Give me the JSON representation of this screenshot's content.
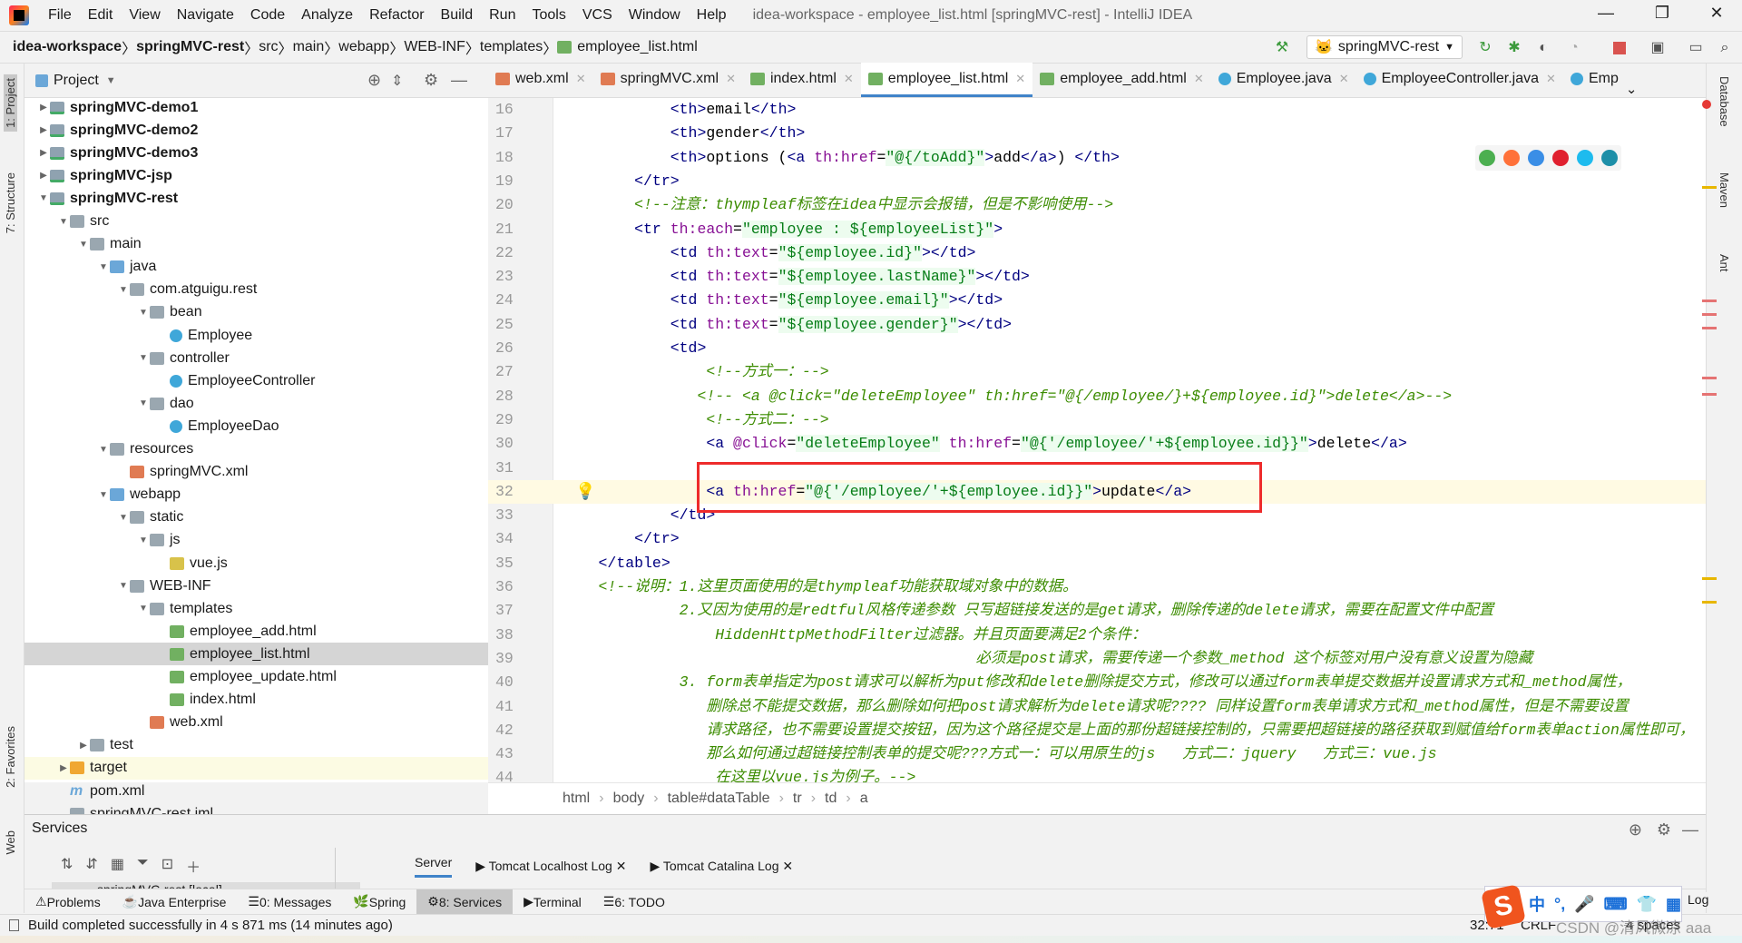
{
  "window": {
    "title": "idea-workspace - employee_list.html [springMVC-rest] - IntelliJ IDEA",
    "minimize": "—",
    "maximize": "❐",
    "close": "✕"
  },
  "menu": [
    "File",
    "Edit",
    "View",
    "Navigate",
    "Code",
    "Analyze",
    "Refactor",
    "Build",
    "Run",
    "Tools",
    "VCS",
    "Window",
    "Help"
  ],
  "navbar": {
    "crumbs": [
      "idea-workspace",
      "springMVC-rest",
      "src",
      "main",
      "webapp",
      "WEB-INF",
      "templates",
      "employee_list.html"
    ],
    "run_config": "springMVC-rest"
  },
  "left_stripe": [
    "1: Project",
    "7: Structure",
    "2: Favorites",
    "Web"
  ],
  "right_stripe": [
    "Database",
    "Maven",
    "Ant"
  ],
  "project": {
    "title": "Project",
    "tree": [
      {
        "label": "springMVC-demo1",
        "depth": 0,
        "arrow": "closed",
        "icon": "module",
        "bold": true
      },
      {
        "label": "springMVC-demo2",
        "depth": 0,
        "arrow": "closed",
        "icon": "module",
        "bold": true
      },
      {
        "label": "springMVC-demo3",
        "depth": 0,
        "arrow": "closed",
        "icon": "module",
        "bold": true
      },
      {
        "label": "springMVC-jsp",
        "depth": 0,
        "arrow": "closed",
        "icon": "module",
        "bold": true
      },
      {
        "label": "springMVC-rest",
        "depth": 0,
        "arrow": "open",
        "icon": "module",
        "bold": true
      },
      {
        "label": "src",
        "depth": 1,
        "arrow": "open",
        "icon": "folder"
      },
      {
        "label": "main",
        "depth": 2,
        "arrow": "open",
        "icon": "folder"
      },
      {
        "label": "java",
        "depth": 3,
        "arrow": "open",
        "icon": "src"
      },
      {
        "label": "com.atguigu.rest",
        "depth": 4,
        "arrow": "open",
        "icon": "folder"
      },
      {
        "label": "bean",
        "depth": 5,
        "arrow": "open",
        "icon": "folder"
      },
      {
        "label": "Employee",
        "depth": 6,
        "arrow": "none",
        "icon": "class"
      },
      {
        "label": "controller",
        "depth": 5,
        "arrow": "open",
        "icon": "folder"
      },
      {
        "label": "EmployeeController",
        "depth": 6,
        "arrow": "none",
        "icon": "class"
      },
      {
        "label": "dao",
        "depth": 5,
        "arrow": "open",
        "icon": "folder"
      },
      {
        "label": "EmployeeDao",
        "depth": 6,
        "arrow": "none",
        "icon": "class"
      },
      {
        "label": "resources",
        "depth": 3,
        "arrow": "open",
        "icon": "folder"
      },
      {
        "label": "springMVC.xml",
        "depth": 4,
        "arrow": "none",
        "icon": "xml"
      },
      {
        "label": "webapp",
        "depth": 3,
        "arrow": "open",
        "icon": "src"
      },
      {
        "label": "static",
        "depth": 4,
        "arrow": "open",
        "icon": "folder"
      },
      {
        "label": "js",
        "depth": 5,
        "arrow": "open",
        "icon": "folder"
      },
      {
        "label": "vue.js",
        "depth": 6,
        "arrow": "none",
        "icon": "js"
      },
      {
        "label": "WEB-INF",
        "depth": 4,
        "arrow": "open",
        "icon": "folder"
      },
      {
        "label": "templates",
        "depth": 5,
        "arrow": "open",
        "icon": "folder"
      },
      {
        "label": "employee_add.html",
        "depth": 6,
        "arrow": "none",
        "icon": "html"
      },
      {
        "label": "employee_list.html",
        "depth": 6,
        "arrow": "none",
        "icon": "html",
        "selected": true
      },
      {
        "label": "employee_update.html",
        "depth": 6,
        "arrow": "none",
        "icon": "html"
      },
      {
        "label": "index.html",
        "depth": 6,
        "arrow": "none",
        "icon": "html"
      },
      {
        "label": "web.xml",
        "depth": 5,
        "arrow": "none",
        "icon": "xml"
      },
      {
        "label": "test",
        "depth": 2,
        "arrow": "closed",
        "icon": "folder"
      },
      {
        "label": "target",
        "depth": 1,
        "arrow": "closed",
        "icon": "orange",
        "highlight": true
      },
      {
        "label": "pom.xml",
        "depth": 1,
        "arrow": "none",
        "icon": "mvn"
      },
      {
        "label": "springMVC-rest.iml",
        "depth": 1,
        "arrow": "none",
        "icon": "folder"
      }
    ]
  },
  "editor": {
    "tabs": [
      {
        "label": "web.xml",
        "icon": "xml"
      },
      {
        "label": "springMVC.xml",
        "icon": "xml"
      },
      {
        "label": "index.html",
        "icon": "html"
      },
      {
        "label": "employee_list.html",
        "icon": "html",
        "active": true
      },
      {
        "label": "employee_add.html",
        "icon": "html"
      },
      {
        "label": "Employee.java",
        "icon": "class"
      },
      {
        "label": "EmployeeController.java",
        "icon": "class"
      },
      {
        "label": "Emp",
        "icon": "class"
      }
    ],
    "current_line": 32,
    "lines": [
      {
        "n": 16,
        "tokens": [
          [
            "x",
            "             "
          ],
          [
            "t",
            "<th>"
          ],
          [
            "x",
            "email"
          ],
          [
            "t",
            "</th>"
          ]
        ]
      },
      {
        "n": 17,
        "tokens": [
          [
            "x",
            "             "
          ],
          [
            "t",
            "<th>"
          ],
          [
            "x",
            "gender"
          ],
          [
            "t",
            "</th>"
          ]
        ]
      },
      {
        "n": 18,
        "tokens": [
          [
            "x",
            "             "
          ],
          [
            "t",
            "<th>"
          ],
          [
            "x",
            "options ("
          ],
          [
            "t",
            "<a "
          ],
          [
            "a",
            "th:href"
          ],
          [
            "x",
            "="
          ],
          [
            "s",
            "\"@{/toAdd}\""
          ],
          [
            "t",
            ">"
          ],
          [
            "x",
            "add"
          ],
          [
            "t",
            "</a>"
          ],
          [
            "x",
            ") "
          ],
          [
            "t",
            "</th>"
          ]
        ]
      },
      {
        "n": 19,
        "tokens": [
          [
            "x",
            "         "
          ],
          [
            "t",
            "</tr>"
          ]
        ]
      },
      {
        "n": 20,
        "tokens": [
          [
            "x",
            "         "
          ],
          [
            "c",
            "<!--注意：thympleaf标签在idea中显示会报错，但是不影响使用-->"
          ]
        ]
      },
      {
        "n": 21,
        "tokens": [
          [
            "x",
            "         "
          ],
          [
            "t",
            "<tr "
          ],
          [
            "a",
            "th:each"
          ],
          [
            "x",
            "="
          ],
          [
            "s",
            "\"employee : ${employeeList}\""
          ],
          [
            "t",
            ">"
          ]
        ]
      },
      {
        "n": 22,
        "tokens": [
          [
            "x",
            "             "
          ],
          [
            "t",
            "<td "
          ],
          [
            "a",
            "th:text"
          ],
          [
            "x",
            "="
          ],
          [
            "s",
            "\"${employee.id}\""
          ],
          [
            "t",
            "></td>"
          ]
        ]
      },
      {
        "n": 23,
        "tokens": [
          [
            "x",
            "             "
          ],
          [
            "t",
            "<td "
          ],
          [
            "a",
            "th:text"
          ],
          [
            "x",
            "="
          ],
          [
            "s",
            "\"${employee.lastName}\""
          ],
          [
            "t",
            "></td>"
          ]
        ]
      },
      {
        "n": 24,
        "tokens": [
          [
            "x",
            "             "
          ],
          [
            "t",
            "<td "
          ],
          [
            "a",
            "th:text"
          ],
          [
            "x",
            "="
          ],
          [
            "s",
            "\"${employee.email}\""
          ],
          [
            "t",
            "></td>"
          ]
        ]
      },
      {
        "n": 25,
        "tokens": [
          [
            "x",
            "             "
          ],
          [
            "t",
            "<td "
          ],
          [
            "a",
            "th:text"
          ],
          [
            "x",
            "="
          ],
          [
            "s",
            "\"${employee.gender}\""
          ],
          [
            "t",
            "></td>"
          ]
        ]
      },
      {
        "n": 26,
        "tokens": [
          [
            "x",
            "             "
          ],
          [
            "t",
            "<td>"
          ]
        ]
      },
      {
        "n": 27,
        "tokens": [
          [
            "x",
            "                 "
          ],
          [
            "c",
            "<!--方式一：-->"
          ]
        ]
      },
      {
        "n": 28,
        "tokens": [
          [
            "x",
            "                "
          ],
          [
            "c",
            "<!-- <a @click=\"deleteEmployee\" th:href=\"@{/employee/}+${employee.id}\">delete</a>-->"
          ]
        ]
      },
      {
        "n": 29,
        "tokens": [
          [
            "x",
            "                 "
          ],
          [
            "c",
            "<!--方式二：-->"
          ]
        ]
      },
      {
        "n": 30,
        "tokens": [
          [
            "x",
            "                 "
          ],
          [
            "t",
            "<a "
          ],
          [
            "a",
            "@click"
          ],
          [
            "x",
            "="
          ],
          [
            "s",
            "\"deleteEmployee\""
          ],
          [
            "x",
            " "
          ],
          [
            "a",
            "th:href"
          ],
          [
            "x",
            "="
          ],
          [
            "s",
            "\"@{'/employee/'+${employee.id}}\""
          ],
          [
            "t",
            ">"
          ],
          [
            "x",
            "delete"
          ],
          [
            "t",
            "</a>"
          ]
        ]
      },
      {
        "n": 31,
        "tokens": []
      },
      {
        "n": 32,
        "tokens": [
          [
            "x",
            "                 "
          ],
          [
            "t",
            "<a "
          ],
          [
            "a",
            "th:href"
          ],
          [
            "x",
            "="
          ],
          [
            "s",
            "\"@{'/employee/'+${employee.id}}\""
          ],
          [
            "t",
            ">"
          ],
          [
            "x",
            "update"
          ],
          [
            "t",
            "</a>"
          ]
        ]
      },
      {
        "n": 33,
        "tokens": [
          [
            "x",
            "             "
          ],
          [
            "t",
            "</td>"
          ]
        ]
      },
      {
        "n": 34,
        "tokens": [
          [
            "x",
            "         "
          ],
          [
            "t",
            "</tr>"
          ]
        ]
      },
      {
        "n": 35,
        "tokens": [
          [
            "x",
            "     "
          ],
          [
            "t",
            "</table>"
          ]
        ]
      },
      {
        "n": 36,
        "tokens": [
          [
            "x",
            "     "
          ],
          [
            "c",
            "<!--说明：1.这里页面使用的是thympleaf功能获取域对象中的数据。"
          ]
        ]
      },
      {
        "n": 37,
        "tokens": [
          [
            "x",
            "              "
          ],
          [
            "c",
            "2.又因为使用的是redtful风格传递参数 只写超链接发送的是get请求，删除传递的delete请求，需要在配置文件中配置"
          ]
        ]
      },
      {
        "n": 38,
        "tokens": [
          [
            "x",
            "                  "
          ],
          [
            "c",
            "HiddenHttpMethodFilter过滤器。并且页面要满足2个条件："
          ]
        ]
      },
      {
        "n": 39,
        "tokens": [
          [
            "x",
            "                                               "
          ],
          [
            "c",
            "必须是post请求，需要传递一个参数_method 这个标签对用户没有意义设置为隐藏"
          ]
        ]
      },
      {
        "n": 40,
        "tokens": [
          [
            "x",
            "              "
          ],
          [
            "c",
            "3. form表单指定为post请求可以解析为put修改和delete删除提交方式，修改可以通过form表单提交数据并设置请求方式和_method属性，"
          ]
        ]
      },
      {
        "n": 41,
        "tokens": [
          [
            "x",
            "                 "
          ],
          [
            "c",
            "删除总不能提交数据，那么删除如何把post请求解析为delete请求呢???? 同样设置form表单请求方式和_method属性，但是不需要设置"
          ]
        ]
      },
      {
        "n": 42,
        "tokens": [
          [
            "x",
            "                 "
          ],
          [
            "c",
            "请求路径，也不需要设置提交按钮，因为这个路径提交是上面的那份超链接控制的，只需要把超链接的路径获取到赋值给form表单action属性即可，"
          ]
        ]
      },
      {
        "n": 43,
        "tokens": [
          [
            "x",
            "                 "
          ],
          [
            "c",
            "那么如何通过超链接控制表单的提交呢???方式一：可以用原生的js   方式二：jquery   方式三：vue.js"
          ]
        ]
      },
      {
        "n": 44,
        "tokens": [
          [
            "x",
            "                  "
          ],
          [
            "c",
            "在这里以vue.js为例子。-->"
          ]
        ]
      }
    ],
    "breadcrumbs": [
      "html",
      "body",
      "table#dataTable",
      "tr",
      "td",
      "a"
    ],
    "browser_icons": [
      {
        "name": "chrome",
        "color": "#4caf50"
      },
      {
        "name": "firefox",
        "color": "#ff7139"
      },
      {
        "name": "safari",
        "color": "#3a8ee6"
      },
      {
        "name": "opera",
        "color": "#e0202f"
      },
      {
        "name": "ie",
        "color": "#1ebbee"
      },
      {
        "name": "edge",
        "color": "#1e8fa8"
      }
    ]
  },
  "services": {
    "title": "Services",
    "tree_item": "springMVC-rest [local]",
    "tabs": [
      "Server",
      "Tomcat Localhost Log",
      "Tomcat Catalina Log"
    ]
  },
  "bottom_tabs": [
    {
      "label": "Problems"
    },
    {
      "label": "Java Enterprise"
    },
    {
      "label": "0: Messages"
    },
    {
      "label": "Spring"
    },
    {
      "label": "8: Services",
      "active": true
    },
    {
      "label": "Terminal"
    },
    {
      "label": "6: TODO"
    }
  ],
  "event_log": "Log",
  "status": {
    "message": "Build completed successfully in 4 s 871 ms (14 minutes ago)",
    "position": "32:71",
    "line_sep": "CRLF",
    "indent": "4 spaces"
  },
  "ime": {
    "logo": "S",
    "items": [
      "中",
      "°,",
      "🎤",
      "⌨",
      "👕",
      "▦"
    ]
  },
  "watermark": "CSDN @清风微凉 aaa",
  "colors": {
    "accent": "#4083c9",
    "highlight_box": "#ee2b2b",
    "current_line": "#fffae3"
  }
}
